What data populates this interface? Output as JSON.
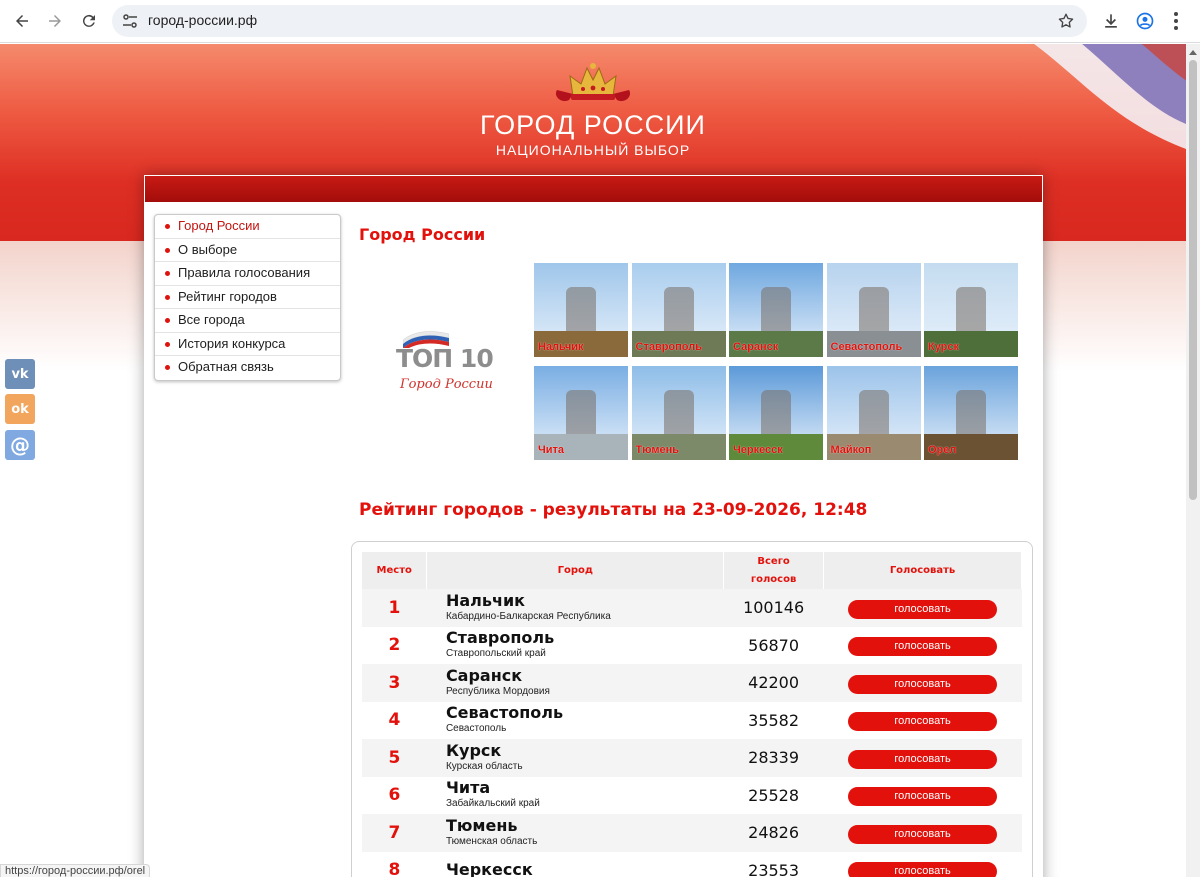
{
  "browser": {
    "url": "город-россии.рф",
    "status_url": "https://город-россии.рф/orel",
    "icons": [
      "back-icon",
      "forward-icon",
      "reload-icon",
      "site-settings-icon",
      "bookmark-star-icon",
      "download-icon",
      "profile-icon",
      "menu-icon"
    ]
  },
  "header": {
    "title": "ГОРОД РОССИИ",
    "subtitle": "НАЦИОНАЛЬНЫЙ ВЫБОР",
    "brand_color": "#e3110b"
  },
  "menu": {
    "items": [
      {
        "label": "Город России",
        "active": true
      },
      {
        "label": "О выборе",
        "active": false
      },
      {
        "label": "Правила голосования",
        "active": false
      },
      {
        "label": "Рейтинг городов",
        "active": false
      },
      {
        "label": "Все города",
        "active": false
      },
      {
        "label": "История конкурса",
        "active": false
      },
      {
        "label": "Обратная связь",
        "active": false
      }
    ]
  },
  "main": {
    "section_title": "Город России",
    "logo": {
      "number_text": "ТОП 10",
      "script_text": "Город России"
    },
    "top_cities": [
      {
        "label": "Нальчик",
        "sky": "#9fc6ea",
        "ground": "#8a6a3a"
      },
      {
        "label": "Ставрополь",
        "sky": "#a9cdee",
        "ground": "#6e7a55"
      },
      {
        "label": "Саранск",
        "sky": "#6fa8e0",
        "ground": "#5c7a48"
      },
      {
        "label": "Севастополь",
        "sky": "#b7d3ee",
        "ground": "#8a8f93"
      },
      {
        "label": "Курск",
        "sky": "#c4dcf0",
        "ground": "#4f6f3a"
      },
      {
        "label": "Чита",
        "sky": "#7aaee3",
        "ground": "#a9b3ba"
      },
      {
        "label": "Тюмень",
        "sky": "#8ebde8",
        "ground": "#7d8a6a"
      },
      {
        "label": "Черкесск",
        "sky": "#5c9ad9",
        "ground": "#5f8a3c"
      },
      {
        "label": "Майкоп",
        "sky": "#9cc3ea",
        "ground": "#9a8a70"
      },
      {
        "label": "Орел",
        "sky": "#6aa3dc",
        "ground": "#6a5232"
      }
    ],
    "rating_title": "Рейтинг городов - результаты на 23-09-2026, 12:48",
    "table": {
      "headers": {
        "place": "Место",
        "city": "Город",
        "votes_line1": "Всего",
        "votes_line2": "голосов",
        "action": "Голосовать"
      },
      "vote_button_label": "голосовать",
      "rows": [
        {
          "place": "1",
          "city": "Нальчик",
          "region": "Кабардино-Балкарская Республика",
          "votes": "100146"
        },
        {
          "place": "2",
          "city": "Ставрополь",
          "region": "Ставропольский край",
          "votes": "56870"
        },
        {
          "place": "3",
          "city": "Саранск",
          "region": "Республика Мордовия",
          "votes": "42200"
        },
        {
          "place": "4",
          "city": "Севастополь",
          "region": "Севастополь",
          "votes": "35582"
        },
        {
          "place": "5",
          "city": "Курск",
          "region": "Курская область",
          "votes": "28339"
        },
        {
          "place": "6",
          "city": "Чита",
          "region": "Забайкальский край",
          "votes": "25528"
        },
        {
          "place": "7",
          "city": "Тюмень",
          "region": "Тюменская область",
          "votes": "24826"
        },
        {
          "place": "8",
          "city": "Черкесск",
          "region": "",
          "votes": "23553"
        }
      ]
    }
  },
  "social": [
    {
      "name": "vk",
      "glyph": "vk",
      "color": "#6d8fb8"
    },
    {
      "name": "odnoklassniki",
      "glyph": "ok",
      "color": "#f2a55d"
    },
    {
      "name": "mail",
      "glyph": "@",
      "color": "#7fa9e0"
    }
  ]
}
